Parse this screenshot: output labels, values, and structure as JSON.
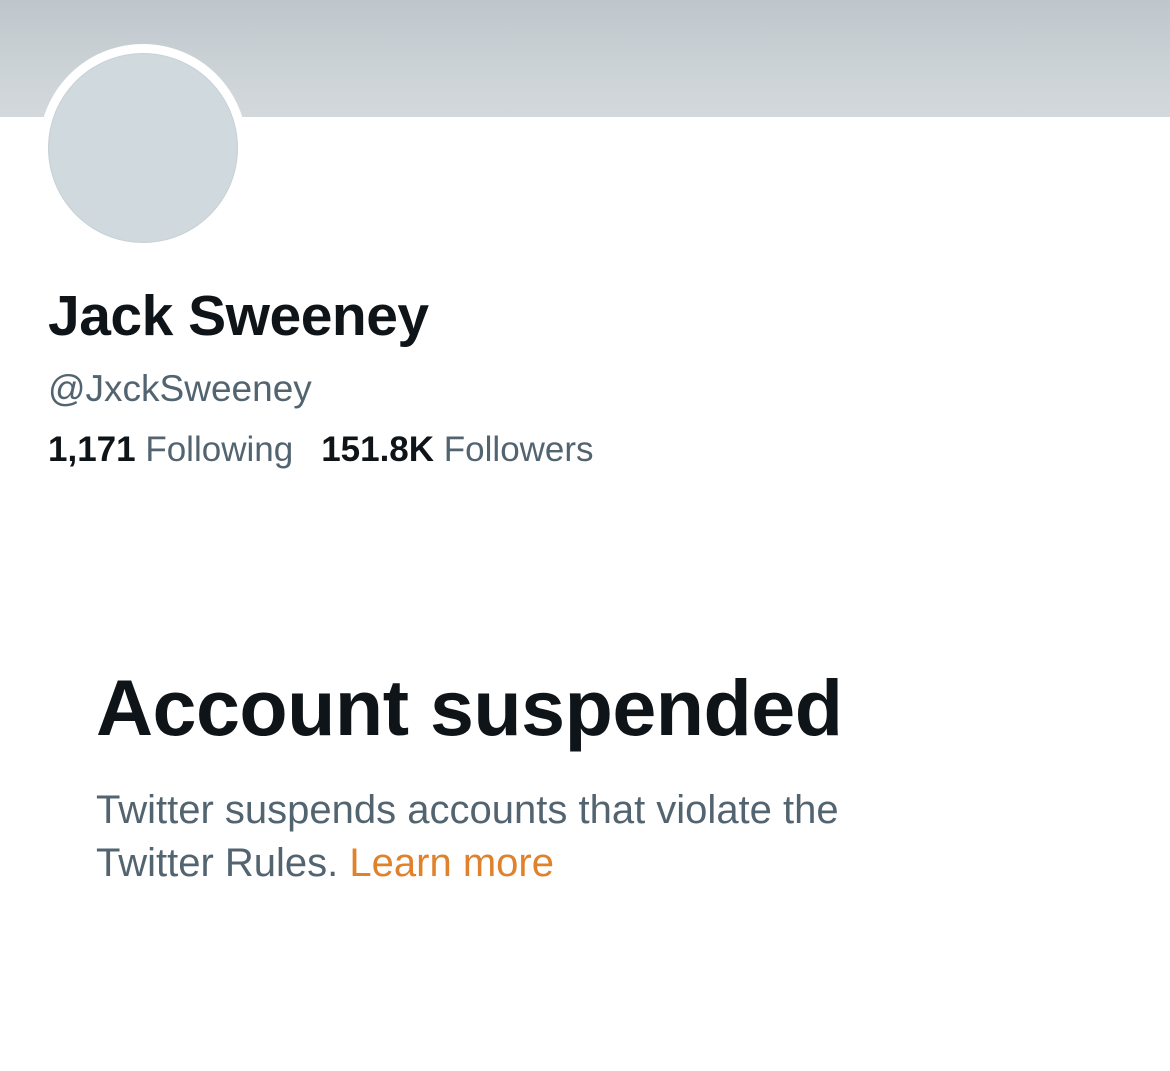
{
  "profile": {
    "display_name": "Jack Sweeney",
    "handle": "@JxckSweeney",
    "following_count": "1,171",
    "following_label": "Following",
    "followers_count": "151.8K",
    "followers_label": "Followers"
  },
  "notice": {
    "title": "Account suspended",
    "body_line1": "Twitter suspends accounts that violate the",
    "body_line2": "Twitter Rules.",
    "learn_more": "Learn more"
  },
  "colors": {
    "banner": "#cbd2d6",
    "avatar_placeholder": "#cfd9de",
    "text_primary": "#0f1419",
    "text_secondary": "#536471",
    "link": "#e0812b"
  }
}
